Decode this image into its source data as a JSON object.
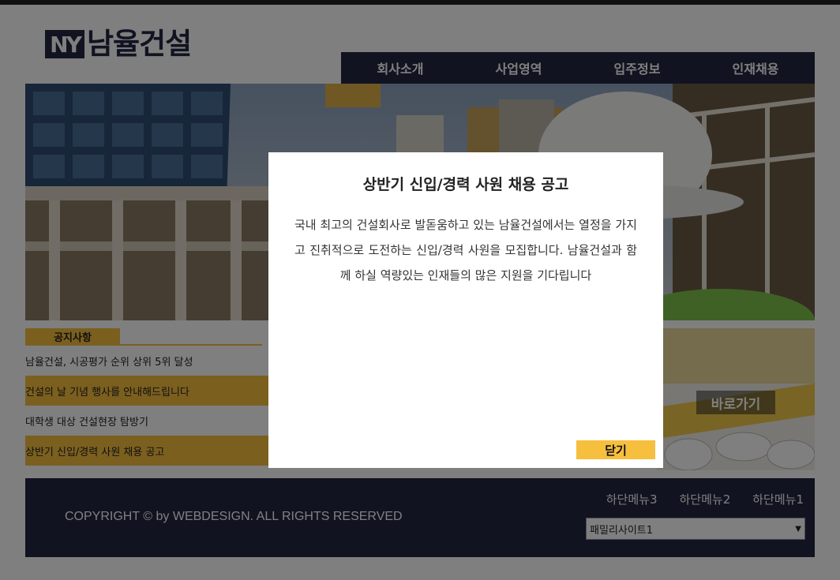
{
  "header": {
    "logo_mark": "NY",
    "logo_text": "남율건설"
  },
  "nav": {
    "items": [
      "회사소개",
      "사업영역",
      "입주정보",
      "인재채용"
    ]
  },
  "notice": {
    "tab_label": "공지사항",
    "items": [
      "남율건설, 시공평가 순위 상위 5위 달성",
      "건설의 날 기념 행사를 안내해드립니다",
      "대학생 대상 건설현장 탐방기",
      "상반기 신입/경력 사원 채용 공고"
    ]
  },
  "quick_link": {
    "label": "바로가기"
  },
  "footer": {
    "copyright": "COPYRIGHT © by WEBDESIGN. ALL RIGHTS RESERVED",
    "menu": [
      "하단메뉴3",
      "하단메뉴2",
      "하단메뉴1"
    ],
    "family_site_selected": "패밀리사이트1"
  },
  "modal": {
    "title": "상반기 신입/경력 사원 채용 공고",
    "body": "국내 최고의 건설회사로 발돋움하고 있는 남율건설에서는 열정을 가지고 진취적으로 도전하는 신입/경력 사원을 모집합니다. 남율건설과 함께 하실 역량있는 인재들의 많은 지원을 기다립니다",
    "close_label": "닫기"
  },
  "colors": {
    "navy": "#222743",
    "accent_yellow": "#f7bf3e",
    "overlay": "rgba(0,0,0,0.5)"
  },
  "icons": [
    "chevron-down-icon"
  ]
}
